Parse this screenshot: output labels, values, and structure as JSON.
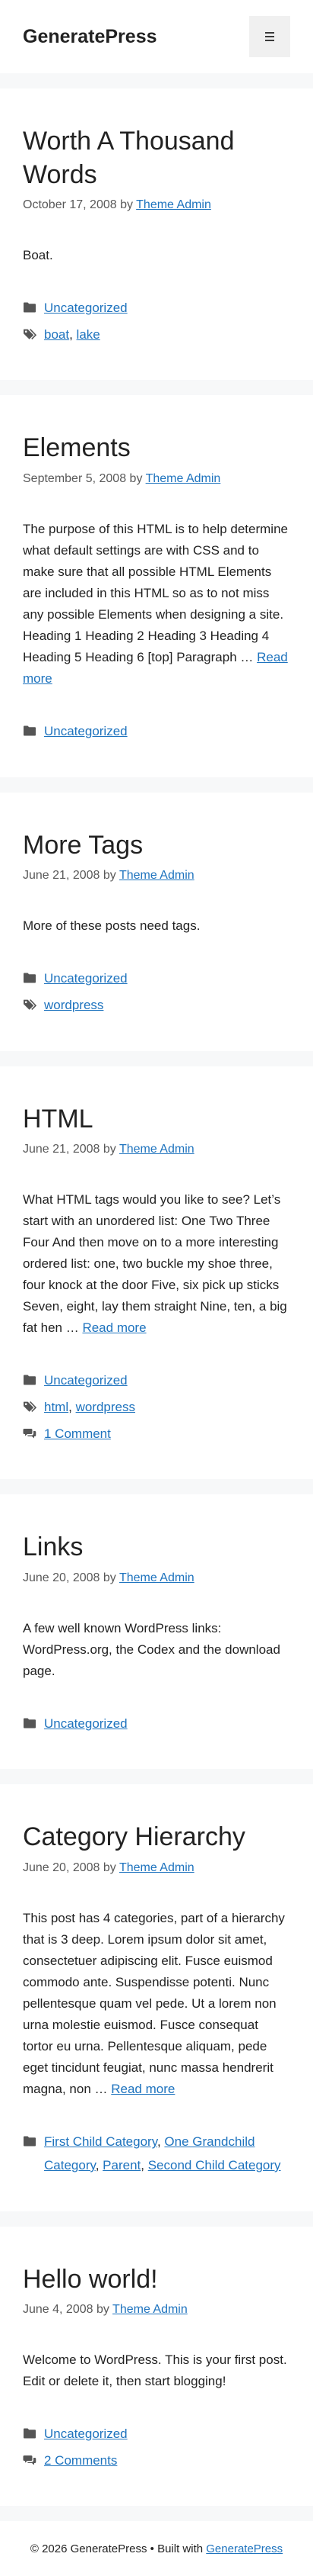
{
  "header": {
    "site_title": "GeneratePress",
    "menu_icon": "hamburger-icon"
  },
  "posts": [
    {
      "title": "Worth A Thousand Words",
      "date": "October 17, 2008",
      "by": "by",
      "author": "Theme Admin",
      "excerpt": "Boat.",
      "read_more": "",
      "categories": [
        "Uncategorized"
      ],
      "tags": [
        "boat",
        "lake"
      ],
      "comments": ""
    },
    {
      "title": "Elements",
      "date": "September 5, 2008",
      "by": "by",
      "author": "Theme Admin",
      "excerpt": "The purpose of this HTML is to help determine what default settings are with CSS and to make sure that all possible HTML Elements are included in this HTML so as to not miss any possible Elements when designing a site. Heading 1 Heading 2 Heading 3 Heading 4 Heading 5 Heading 6 [top] Paragraph …",
      "read_more": "Read more",
      "categories": [
        "Uncategorized"
      ],
      "tags": [],
      "comments": ""
    },
    {
      "title": "More Tags",
      "date": "June 21, 2008",
      "by": "by",
      "author": "Theme Admin",
      "excerpt": "More of these posts need tags.",
      "read_more": "",
      "categories": [
        "Uncategorized"
      ],
      "tags": [
        "wordpress"
      ],
      "comments": ""
    },
    {
      "title": "HTML",
      "date": "June 21, 2008",
      "by": "by",
      "author": "Theme Admin",
      "excerpt": "What HTML tags would you like to see? Let’s start with an unordered list: One Two Three Four And then move on to a more interesting ordered list: one, two buckle my shoe three, four knock at the door Five, six pick up sticks Seven, eight, lay them straight Nine, ten, a big fat hen …",
      "read_more": "Read more",
      "categories": [
        "Uncategorized"
      ],
      "tags": [
        "html",
        "wordpress"
      ],
      "comments": "1 Comment"
    },
    {
      "title": "Links",
      "date": "June 20, 2008",
      "by": "by",
      "author": "Theme Admin",
      "excerpt": "A few well known WordPress links: WordPress.org, the Codex and the download page.",
      "read_more": "",
      "categories": [
        "Uncategorized"
      ],
      "tags": [],
      "comments": ""
    },
    {
      "title": "Category Hierarchy",
      "date": "June 20, 2008",
      "by": "by",
      "author": "Theme Admin",
      "excerpt": "This post has 4 categories, part of a hierarchy that is 3 deep. Lorem ipsum dolor sit amet, consectetuer adipiscing elit. Fusce euismod commodo ante. Suspendisse potenti. Nunc pellentesque quam vel pede. Ut a lorem non urna molestie euismod. Fusce consequat tortor eu urna. Pellentesque aliquam, pede eget tincidunt feugiat, nunc massa hendrerit magna, non …",
      "read_more": "Read more",
      "categories": [
        "First Child Category",
        "One Grandchild Category",
        "Parent",
        "Second Child Category"
      ],
      "tags": [],
      "comments": ""
    },
    {
      "title": "Hello world!",
      "date": "June 4, 2008",
      "by": "by",
      "author": "Theme Admin",
      "excerpt": "Welcome to WordPress. This is your first post. Edit or delete it, then start blogging!",
      "read_more": "",
      "categories": [
        "Uncategorized"
      ],
      "tags": [],
      "comments": "2 Comments"
    }
  ],
  "footer": {
    "copyright": "© 2026 GeneratePress • Built with",
    "link": "GeneratePress"
  },
  "colors": {
    "link": "#1e73be",
    "background": "#f7f8f9",
    "meta_text": "#595959"
  }
}
